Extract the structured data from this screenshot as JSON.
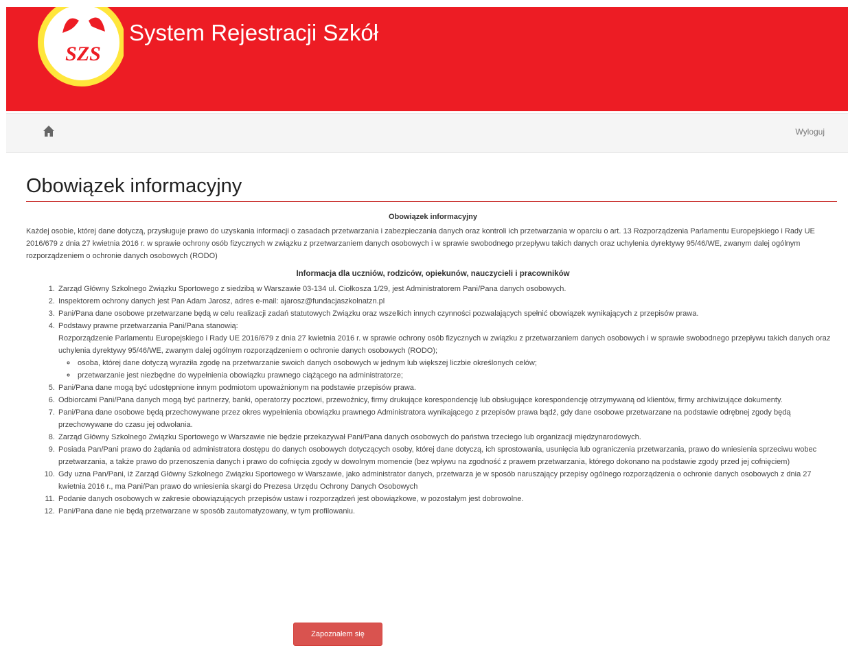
{
  "header": {
    "logo_text": "SZS",
    "title": "System Rejestracji Szkół"
  },
  "navbar": {
    "home_icon": "home-icon",
    "logout_label": "Wyloguj"
  },
  "page": {
    "title": "Obowiązek informacyjny",
    "heading": "Obowiązek informacyjny",
    "intro": "Każdej osobie, której dane dotyczą, przysługuje prawo do uzyskania informacji o zasadach przetwarzania i zabezpieczania danych oraz kontroli ich przetwarzania w oparciu o art. 13 Rozporządzenia Parlamentu Europejskiego i Rady UE 2016/679 z dnia 27 kwietnia 2016 r. w sprawie ochrony osób fizycznych w związku z przetwarzaniem danych osobowych i w sprawie swobodnego przepływu takich danych oraz uchylenia dyrektywy 95/46/WE, zwanym dalej ogólnym rozporządzeniem o ochronie danych osobowych (RODO)",
    "section_heading": "Informacja dla uczniów, rodziców, opiekunów, nauczycieli i pracowników",
    "items": [
      "Zarząd Główny Szkolnego Związku Sportowego z siedzibą w Warszawie 03-134 ul. Ciołkosza 1/29, jest Administratorem Pani/Pana danych osobowych.",
      "Inspektorem ochrony danych jest Pan Adam Jarosz, adres e-mail: ajarosz@fundacjaszkolnatzn.pl",
      "Pani/Pana dane osobowe przetwarzane będą w celu realizacji zadań statutowych Związku oraz wszelkich innych czynności pozwalających spełnić obowiązek wynikających z przepisów prawa.",
      "Podstawy prawne przetwarzania Pani/Pana stanowią:",
      "Pani/Pana dane mogą być udostępnione innym podmiotom upoważnionym na podstawie przepisów prawa.",
      "Odbiorcami Pani/Pana danych mogą być partnerzy, banki, operatorzy pocztowi, przewoźnicy, firmy drukujące korespondencję lub obsługujące korespondencję otrzymywaną od klientów, firmy archiwizujące dokumenty.",
      "Pani/Pana dane osobowe będą przechowywane przez okres wypełnienia obowiązku prawnego Administratora wynikającego z przepisów prawa bądź, gdy dane osobowe przetwarzane na podstawie odrębnej zgody będą przechowywane do czasu jej odwołania.",
      "Zarząd Główny Szkolnego Związku Sportowego w Warszawie nie będzie przekazywał Pani/Pana danych osobowych do państwa trzeciego lub organizacji międzynarodowych.",
      "Posiada Pan/Pani prawo do żądania od administratora dostępu do danych osobowych dotyczących osoby, której dane dotyczą, ich sprostowania, usunięcia lub ograniczenia przetwarzania, prawo do wniesienia sprzeciwu wobec przetwarzania, a także prawo do przenoszenia danych i prawo do cofnięcia zgody w dowolnym momencie (bez wpływu na zgodność z prawem przetwarzania, którego dokonano na podstawie zgody przed jej cofnięciem)",
      "Gdy uzna Pan/Pani, iż Zarząd Główny Szkolnego Związku Sportowego w Warszawie, jako administrator danych, przetwarza je w sposób naruszający przepisy ogólnego rozporządzenia o ochronie danych osobowych z dnia 27 kwietnia 2016 r., ma Pani/Pan prawo do wniesienia skargi do Prezesa Urzędu Ochrony Danych Osobowych",
      "Podanie danych osobowych w zakresie obowiązujących przepisów ustaw i rozporządzeń jest obowiązkowe, w pozostałym jest dobrowolne.",
      "Pani/Pana dane nie będą przetwarzane w sposób zautomatyzowany, w tym profilowaniu."
    ],
    "item4_detail": "Rozporządzenie Parlamentu Europejskiego i Rady UE 2016/679 z dnia 27 kwietnia 2016 r. w sprawie ochrony osób fizycznych w związku z przetwarzaniem danych osobowych i w sprawie swobodnego przepływu takich danych oraz uchylenia dyrektywy 95/46/WE, zwanym dalej ogólnym rozporządzeniem o ochronie danych osobowych (RODO);",
    "item4_sub": [
      "osoba, której dane dotyczą wyraziła zgodę na przetwarzanie swoich danych osobowych w jednym lub większej liczbie określonych celów;",
      "przetwarzanie jest niezbędne do wypełnienia obowiązku prawnego ciążącego na administratorze;"
    ],
    "confirm_label": "Zapoznałem się"
  },
  "colors": {
    "header_red": "#ed1c24",
    "logo_yellow": "#ffe63b",
    "button_red": "#d9534f"
  }
}
